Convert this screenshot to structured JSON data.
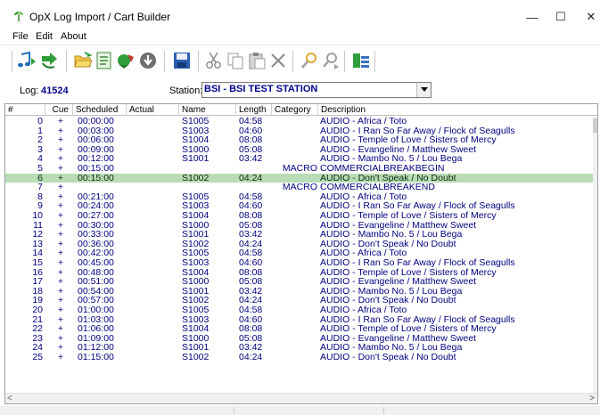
{
  "window": {
    "title": "OpX Log Import / Cart Builder",
    "minimize_glyph": "—",
    "maximize_glyph": "☐",
    "close_glyph": "✕"
  },
  "menu": {
    "file": "File",
    "edit": "Edit",
    "about": "About"
  },
  "toolbar": {
    "icons": [
      "import-audio-icon",
      "import-log-icon",
      "open-folder-icon",
      "edit-list-icon",
      "build-carts-icon",
      "download-icon",
      "save-icon",
      "cut-icon",
      "copy-icon",
      "paste-icon",
      "delete-icon",
      "find-icon",
      "find-next-icon",
      "station-settings-icon"
    ]
  },
  "log": {
    "label": "Log:",
    "value": "41524"
  },
  "station": {
    "label": "Station:",
    "value": "BSI - BSI TEST STATION"
  },
  "grid": {
    "headers": [
      "#",
      "Cue",
      "Scheduled",
      "Actual",
      "Name",
      "Length",
      "Category",
      "Description"
    ],
    "selected_index": 6,
    "rows": [
      {
        "num": "0",
        "cue": "+",
        "scheduled": "00:00:00",
        "actual": "",
        "name": "S1005",
        "length": "04:58",
        "category": "",
        "description": "AUDIO - Africa / Toto"
      },
      {
        "num": "1",
        "cue": "+",
        "scheduled": "00:03:00",
        "actual": "",
        "name": "S1003",
        "length": "04:60",
        "category": "",
        "description": "AUDIO - I Ran So Far Away / Flock of Seagulls"
      },
      {
        "num": "2",
        "cue": "+",
        "scheduled": "00:06:00",
        "actual": "",
        "name": "S1004",
        "length": "08:08",
        "category": "",
        "description": "AUDIO - Temple of Love / Sisters of Mercy"
      },
      {
        "num": "3",
        "cue": "+",
        "scheduled": "00:09:00",
        "actual": "",
        "name": "S1000",
        "length": "05:08",
        "category": "",
        "description": "AUDIO - Evangeline / Matthew Sweet"
      },
      {
        "num": "4",
        "cue": "+",
        "scheduled": "00:12:00",
        "actual": "",
        "name": "S1001",
        "length": "03:42",
        "category": "",
        "description": "AUDIO - Mambo No. 5 / Lou Bega"
      },
      {
        "num": "5",
        "cue": "+",
        "scheduled": "00:15:00",
        "actual": "",
        "name": "",
        "length": "",
        "category": "MACRO",
        "description": "COMMERCIALBREAKBEGIN"
      },
      {
        "num": "6",
        "cue": "+",
        "scheduled": "00:15:00",
        "actual": "",
        "name": "S1002",
        "length": "04:24",
        "category": "",
        "description": "AUDIO - Don't Speak / No Doubt"
      },
      {
        "num": "7",
        "cue": "+",
        "scheduled": "",
        "actual": "",
        "name": "",
        "length": "",
        "category": "MACRO",
        "description": "COMMERCIALBREAKEND"
      },
      {
        "num": "8",
        "cue": "+",
        "scheduled": "00:21:00",
        "actual": "",
        "name": "S1005",
        "length": "04:58",
        "category": "",
        "description": "AUDIO - Africa / Toto"
      },
      {
        "num": "9",
        "cue": "+",
        "scheduled": "00:24:00",
        "actual": "",
        "name": "S1003",
        "length": "04:60",
        "category": "",
        "description": "AUDIO - I Ran So Far Away / Flock of Seagulls"
      },
      {
        "num": "10",
        "cue": "+",
        "scheduled": "00:27:00",
        "actual": "",
        "name": "S1004",
        "length": "08:08",
        "category": "",
        "description": "AUDIO - Temple of Love / Sisters of Mercy"
      },
      {
        "num": "11",
        "cue": "+",
        "scheduled": "00:30:00",
        "actual": "",
        "name": "S1000",
        "length": "05:08",
        "category": "",
        "description": "AUDIO - Evangeline / Matthew Sweet"
      },
      {
        "num": "12",
        "cue": "+",
        "scheduled": "00:33:00",
        "actual": "",
        "name": "S1001",
        "length": "03:42",
        "category": "",
        "description": "AUDIO - Mambo No. 5 / Lou Bega"
      },
      {
        "num": "13",
        "cue": "+",
        "scheduled": "00:36:00",
        "actual": "",
        "name": "S1002",
        "length": "04:24",
        "category": "",
        "description": "AUDIO - Don't Speak / No Doubt"
      },
      {
        "num": "14",
        "cue": "+",
        "scheduled": "00:42:00",
        "actual": "",
        "name": "S1005",
        "length": "04:58",
        "category": "",
        "description": "AUDIO - Africa / Toto"
      },
      {
        "num": "15",
        "cue": "+",
        "scheduled": "00:45:00",
        "actual": "",
        "name": "S1003",
        "length": "04:60",
        "category": "",
        "description": "AUDIO - I Ran So Far Away / Flock of Seagulls"
      },
      {
        "num": "16",
        "cue": "+",
        "scheduled": "00:48:00",
        "actual": "",
        "name": "S1004",
        "length": "08:08",
        "category": "",
        "description": "AUDIO - Temple of Love / Sisters of Mercy"
      },
      {
        "num": "17",
        "cue": "+",
        "scheduled": "00:51:00",
        "actual": "",
        "name": "S1000",
        "length": "05:08",
        "category": "",
        "description": "AUDIO - Evangeline / Matthew Sweet"
      },
      {
        "num": "18",
        "cue": "+",
        "scheduled": "00:54:00",
        "actual": "",
        "name": "S1001",
        "length": "03:42",
        "category": "",
        "description": "AUDIO - Mambo No. 5 / Lou Bega"
      },
      {
        "num": "19",
        "cue": "+",
        "scheduled": "00:57:00",
        "actual": "",
        "name": "S1002",
        "length": "04:24",
        "category": "",
        "description": "AUDIO - Don't Speak / No Doubt"
      },
      {
        "num": "20",
        "cue": "+",
        "scheduled": "01:00:00",
        "actual": "",
        "name": "S1005",
        "length": "04:58",
        "category": "",
        "description": "AUDIO - Africa / Toto"
      },
      {
        "num": "21",
        "cue": "+",
        "scheduled": "01:03:00",
        "actual": "",
        "name": "S1003",
        "length": "04:60",
        "category": "",
        "description": "AUDIO - I Ran So Far Away / Flock of Seagulls"
      },
      {
        "num": "22",
        "cue": "+",
        "scheduled": "01:06:00",
        "actual": "",
        "name": "S1004",
        "length": "08:08",
        "category": "",
        "description": "AUDIO - Temple of Love / Sisters of Mercy"
      },
      {
        "num": "23",
        "cue": "+",
        "scheduled": "01:09:00",
        "actual": "",
        "name": "S1000",
        "length": "05:08",
        "category": "",
        "description": "AUDIO - Evangeline / Matthew Sweet"
      },
      {
        "num": "24",
        "cue": "+",
        "scheduled": "01:12:00",
        "actual": "",
        "name": "S1001",
        "length": "03:42",
        "category": "",
        "description": "AUDIO - Mambo No. 5 / Lou Bega"
      },
      {
        "num": "25",
        "cue": "+",
        "scheduled": "01:15:00",
        "actual": "",
        "name": "S1002",
        "length": "04:24",
        "category": "",
        "description": "AUDIO - Don't Speak / No Doubt"
      }
    ]
  },
  "scrollbar": {
    "left_arrow": "<",
    "right_arrow": ">"
  }
}
